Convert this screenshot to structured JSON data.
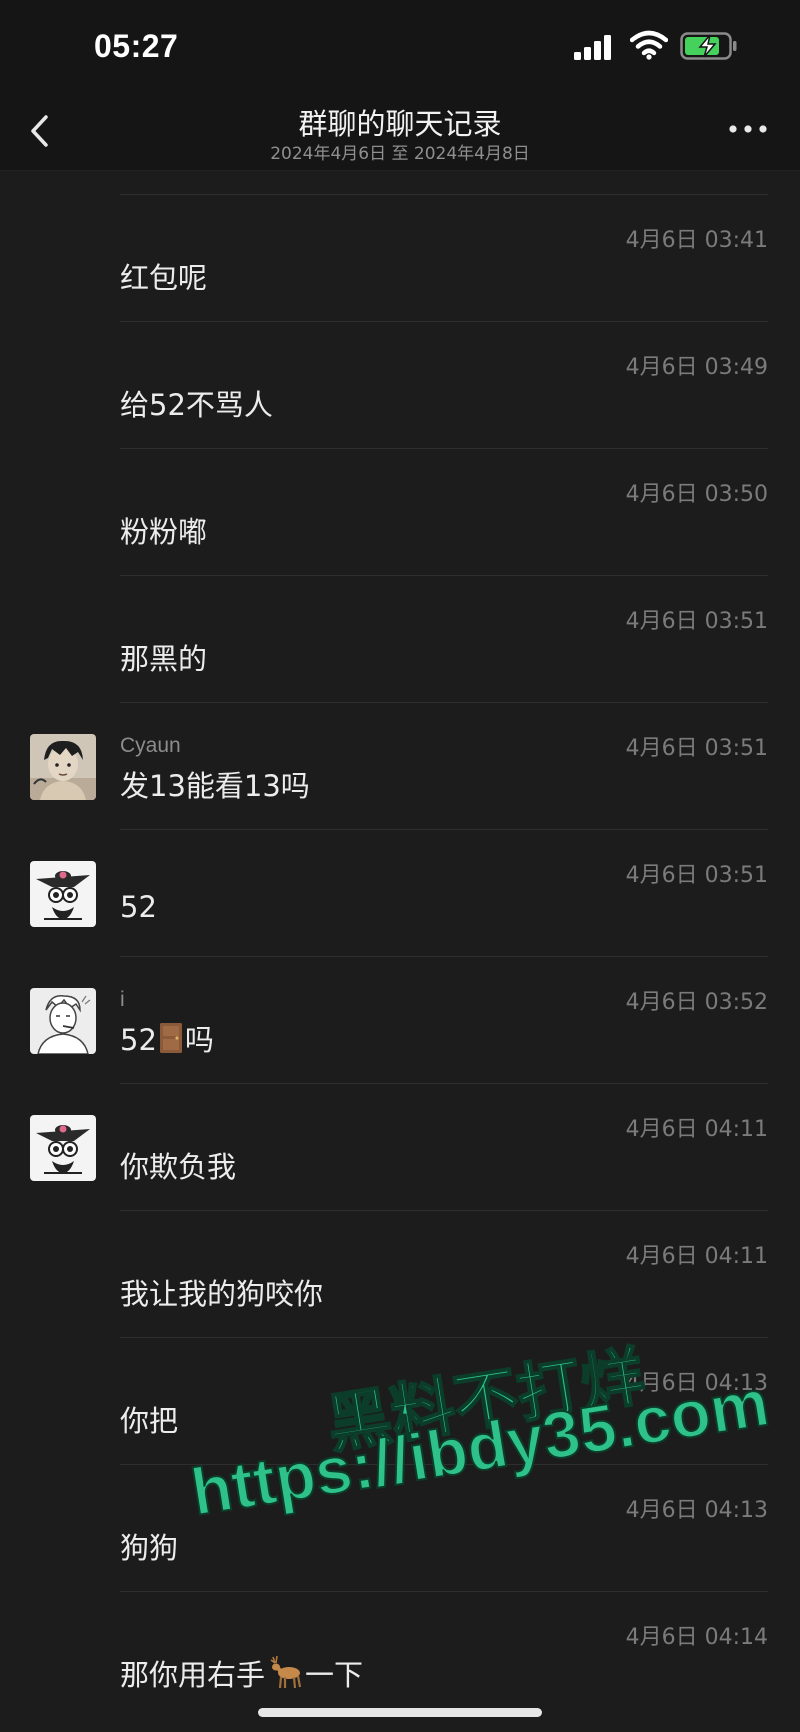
{
  "status_bar": {
    "time": "05:27"
  },
  "header": {
    "title": "群聊的聊天记录",
    "subtitle": "2024年4月6日 至 2024年4月8日"
  },
  "messages": [
    {
      "sender": "",
      "avatar": "",
      "time": "4月6日 03:41",
      "text": "红包呢"
    },
    {
      "sender": "",
      "avatar": "",
      "time": "4月6日 03:49",
      "text": "给52不骂人"
    },
    {
      "sender": "",
      "avatar": "",
      "time": "4月6日 03:50",
      "text": "粉粉嘟"
    },
    {
      "sender": "",
      "avatar": "",
      "time": "4月6日 03:51",
      "text": "那黑的"
    },
    {
      "sender": "Cyaun",
      "avatar": "anime-boy",
      "time": "4月6日 03:51",
      "text": "发13能看13吗"
    },
    {
      "sender": "",
      "avatar": "monkey-hat",
      "time": "4月6日 03:51",
      "text": "52"
    },
    {
      "sender": "i",
      "avatar": "sketch-man",
      "time": "4月6日 03:52",
      "text_before": "52",
      "emoji": "door",
      "text_after": "吗"
    },
    {
      "sender": "",
      "avatar": "monkey-hat",
      "time": "4月6日 04:11",
      "text": "你欺负我"
    },
    {
      "sender": "",
      "avatar": "",
      "time": "4月6日 04:11",
      "text": "我让我的狗咬你"
    },
    {
      "sender": "",
      "avatar": "",
      "time": "4月6日 04:13",
      "text": "你把"
    },
    {
      "sender": "",
      "avatar": "",
      "time": "4月6日 04:13",
      "text": "狗狗"
    },
    {
      "sender": "",
      "avatar": "",
      "time": "4月6日 04:14",
      "text_before": "那你用右手",
      "emoji": "deer",
      "text_after": "一下"
    }
  ],
  "watermark": {
    "line1": "黑料不打烊",
    "line2": "https://ibdy35.com",
    "color": "#2ec28a"
  }
}
